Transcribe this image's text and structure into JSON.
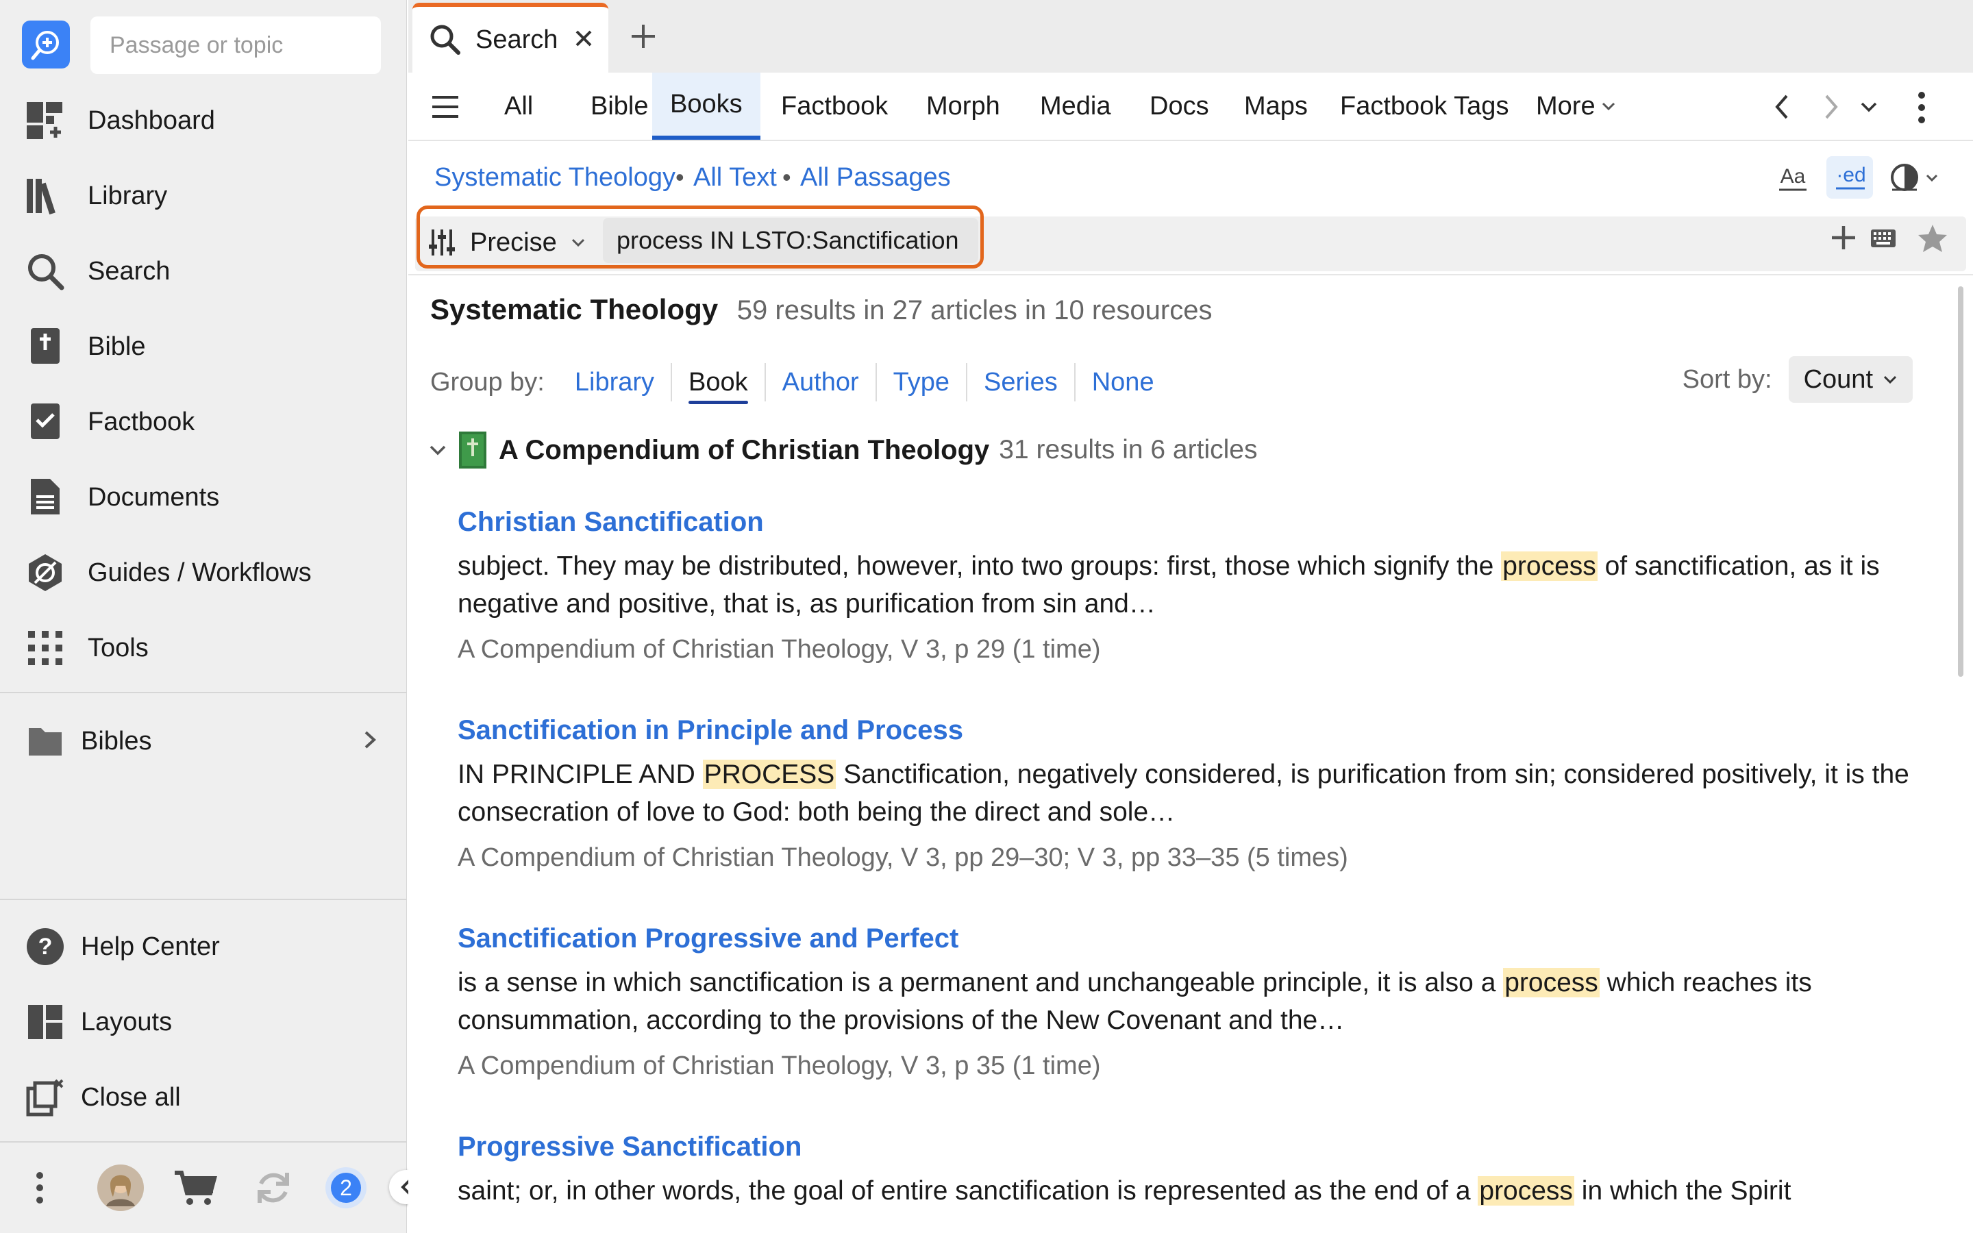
{
  "sidebar": {
    "search_placeholder": "Passage or topic",
    "nav": [
      {
        "label": "Dashboard",
        "icon": "dashboard-icon"
      },
      {
        "label": "Library",
        "icon": "library-icon"
      },
      {
        "label": "Search",
        "icon": "search-icon"
      },
      {
        "label": "Bible",
        "icon": "bible-icon"
      },
      {
        "label": "Factbook",
        "icon": "factbook-icon"
      },
      {
        "label": "Documents",
        "icon": "documents-icon"
      },
      {
        "label": "Guides / Workflows",
        "icon": "guides-icon"
      },
      {
        "label": "Tools",
        "icon": "tools-icon"
      }
    ],
    "folder": {
      "label": "Bibles",
      "icon": "folder-icon"
    },
    "bottom": [
      {
        "label": "Help Center",
        "icon": "help-icon"
      },
      {
        "label": "Layouts",
        "icon": "layouts-icon"
      },
      {
        "label": "Close all",
        "icon": "close-all-icon"
      }
    ],
    "sync_badge": "2"
  },
  "tab": {
    "label": "Search"
  },
  "toolbar": {
    "tabs": [
      "All",
      "Bible",
      "Books",
      "Factbook",
      "Morph",
      "Media",
      "Docs",
      "Maps",
      "Factbook Tags",
      "More"
    ],
    "active_tab": "Books"
  },
  "scope": {
    "collection": "Systematic Theology",
    "range": "All Text",
    "passages": "All Passages"
  },
  "query": {
    "mode": "Precise",
    "text": "process IN LSTO:Sanctification"
  },
  "results": {
    "title": "Systematic Theology",
    "stats": "59 results in 27 articles in 10 resources",
    "group_by_label": "Group by:",
    "group_options": [
      "Library",
      "Book",
      "Author",
      "Type",
      "Series",
      "None"
    ],
    "group_active": "Book",
    "sort_label": "Sort by:",
    "sort_value": "Count",
    "book": {
      "title": "A Compendium of Christian Theology",
      "stats": "31 results in 6 articles"
    },
    "items": [
      {
        "title": "Christian Sanctification",
        "before": "subject. They may be distributed, however, into two groups: first, those which signify the ",
        "hit": "process",
        "after": " of sanctification, as it is negative and positive, that is, as purification from sin and…",
        "cite": "A Compendium of Christian Theology, V 3, p 29 (1 time)"
      },
      {
        "title": "Sanctification in Principle and Process",
        "before": "IN PRINCIPLE AND ",
        "hit": "PROCESS",
        "after": " Sanctification, negatively considered, is purification from sin; considered positively, it is the consecration of love to God: both being the direct and sole…",
        "cite": "A Compendium of Christian Theology, V 3, pp 29–30; V 3, pp 33–35 (5 times)"
      },
      {
        "title": "Sanctification Progressive and Perfect",
        "before": "is a sense in which sanctification is a permanent and unchangeable principle, it is also a ",
        "hit": "process",
        "after": " which reaches its consummation, according to the provisions of the New Covenant and the…",
        "cite": "A Compendium of Christian Theology, V 3, p 35 (1 time)"
      },
      {
        "title": "Progressive Sanctification",
        "before": "saint; or, in other words, the goal of entire sanctification is represented as the end of a ",
        "hit": "process",
        "after": " in which the Spirit",
        "cite": ""
      }
    ]
  },
  "colors": {
    "accent": "#2d6fd6",
    "highlight": "#fdebb6",
    "focus_outline": "#e2661c",
    "logo": "#3b82f6"
  }
}
